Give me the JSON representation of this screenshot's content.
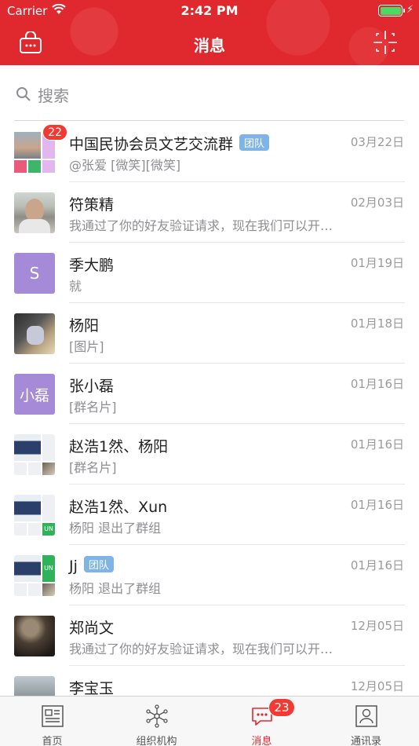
{
  "status": {
    "carrier": "Carrier",
    "time": "2:42 PM"
  },
  "nav": {
    "title": "消息"
  },
  "search": {
    "placeholder": "搜索"
  },
  "colors": {
    "brand": "#e0292e",
    "badge": "#f23a33",
    "tag": "#7fb4e8",
    "avatar_letter_bg": "#a58ad8"
  },
  "conversations": [
    {
      "title": "中国民协会员文艺交流群",
      "tag": "团队",
      "preview": "@张爱 [微笑][微笑]",
      "date": "03月22日",
      "badge": "22",
      "avatar": "group-grid"
    },
    {
      "title": "符策精",
      "preview": "我通过了你的好友验证请求，现在我们可以开始聊天了",
      "date": "02月03日",
      "avatar": "photo"
    },
    {
      "title": "季大鹏",
      "preview": "就",
      "date": "01月19日",
      "avatar_text": "S"
    },
    {
      "title": "杨阳",
      "preview": "[图片]",
      "date": "01月18日",
      "avatar": "photo"
    },
    {
      "title": "张小磊",
      "preview": "[群名片]",
      "date": "01月16日",
      "avatar_text": "小磊"
    },
    {
      "title": "赵浩1然、杨阳",
      "preview": "[群名片]",
      "date": "01月16日",
      "avatar": "group-grid"
    },
    {
      "title": "赵浩1然、Xun",
      "preview": "杨阳 退出了群组",
      "date": "01月16日",
      "avatar": "group-grid",
      "avatar_cell": "UN"
    },
    {
      "title": "Jj",
      "tag": "团队",
      "preview": "杨阳 退出了群组",
      "date": "01月16日",
      "avatar": "group-grid",
      "avatar_cell": "UN"
    },
    {
      "title": "郑尚文",
      "preview": "我通过了你的好友验证请求，现在我们可以开始聊天了",
      "date": "12月05日",
      "avatar": "photo"
    },
    {
      "title": "李宝玉",
      "preview": "",
      "date": "12月05日",
      "avatar": "photo"
    }
  ],
  "tabbar": {
    "tabs": [
      {
        "label": "首页",
        "icon": "news-icon"
      },
      {
        "label": "组织机构",
        "icon": "network-icon"
      },
      {
        "label": "消息",
        "icon": "chat-icon",
        "badge": "23",
        "active": true
      },
      {
        "label": "通讯录",
        "icon": "contacts-icon"
      }
    ]
  }
}
